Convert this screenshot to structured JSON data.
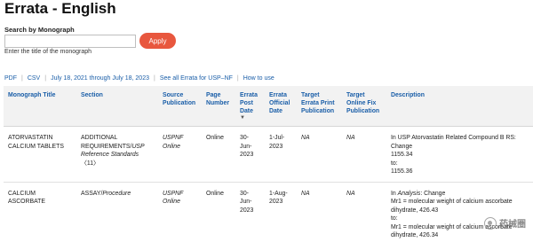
{
  "title": "Errata - English",
  "search": {
    "label": "Search by Monograph",
    "placeholder": "",
    "button": "Apply",
    "hint": "Enter the title of the monograph"
  },
  "links": [
    "PDF",
    "CSV",
    "July 18, 2021 through July 18, 2023",
    "See all Errata for USP–NF",
    "How to use"
  ],
  "colors": {
    "accent": "#e8573e",
    "link": "#1a5ea8",
    "header_bg": "#f2f2f2"
  },
  "table": {
    "headers": {
      "monograph": "Monograph Title",
      "section": "Section",
      "source": "Source Publication",
      "page": "Page Number",
      "post": "Errata Post Date",
      "official": "Errata Official Date",
      "print": "Target Errata Print Publication",
      "online": "Target Online Fix Publication",
      "description": "Description"
    },
    "rows": [
      {
        "monograph": "ATORVASTATIN CALCIUM TABLETS",
        "section_main": "ADDITIONAL REQUIREMENTS/",
        "section_italic": "USP Reference Standards",
        "section_num": "〈11〉",
        "source": "USPNF Online",
        "page": "Online",
        "post": "30-Jun-2023",
        "official": "1-Jul-2023",
        "print": "NA",
        "online": "NA",
        "desc1": "In USP Atorvastatin Related Compound B RS: Change",
        "desc2": "1155.34",
        "desc3": "to:",
        "desc4": "1155.36"
      },
      {
        "monograph": "CALCIUM ASCORBATE",
        "section_main": "ASSAY/",
        "section_italic": "Procedure",
        "section_num": "",
        "source": "USPNF Online",
        "page": "Online",
        "post": "30-Jun-2023",
        "official": "1-Aug-2023",
        "print": "NA",
        "online": "NA",
        "desc1_pre": "In ",
        "desc1_italic": "Analysis",
        "desc1_post": ": Change",
        "desc2": "Mr1 = molecular weight of calcium ascorbate dihydrate, 426.43",
        "desc3": "to:",
        "desc4": "Mr1 = molecular weight of calcium ascorbate dihydrate, 426.34"
      }
    ]
  },
  "watermark": "药械圈"
}
